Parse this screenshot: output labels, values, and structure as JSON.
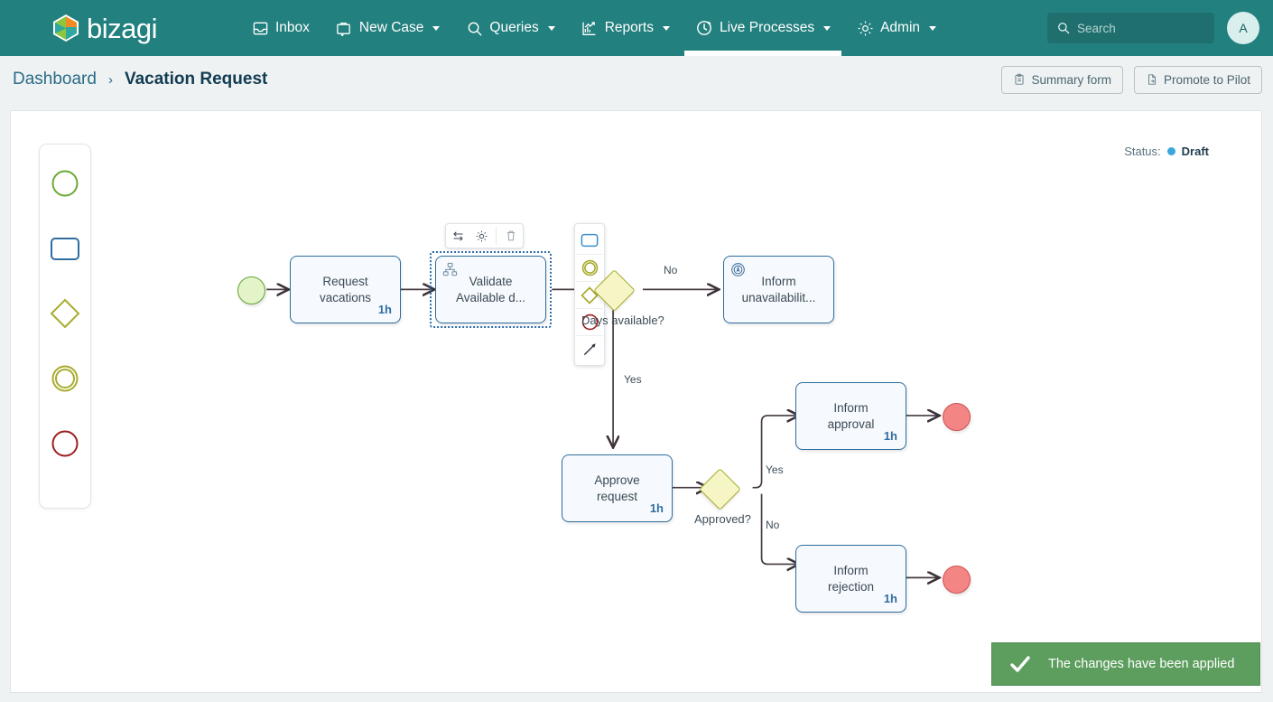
{
  "app": {
    "brand": "bizagi",
    "theme_color": "#22807e"
  },
  "nav": {
    "items": [
      {
        "label": "Inbox",
        "icon": "inbox-icon",
        "has_caret": false,
        "active": false
      },
      {
        "label": "New Case",
        "icon": "new-case-icon",
        "has_caret": true,
        "active": false
      },
      {
        "label": "Queries",
        "icon": "search-icon",
        "has_caret": true,
        "active": false
      },
      {
        "label": "Reports",
        "icon": "reports-chart-icon",
        "has_caret": true,
        "active": false
      },
      {
        "label": "Live Processes",
        "icon": "live-processes-icon",
        "has_caret": true,
        "active": true
      },
      {
        "label": "Admin",
        "icon": "gear-icon",
        "has_caret": true,
        "active": false
      }
    ],
    "search": {
      "value": "",
      "placeholder": "Search"
    },
    "avatar_initial": "A"
  },
  "breadcrumb": {
    "parent": "Dashboard",
    "separator": "›",
    "current": "Vacation Request",
    "actions": [
      {
        "label": "Summary form",
        "icon": "clipboard-icon"
      },
      {
        "label": "Promote to Pilot",
        "icon": "promote-file-icon"
      }
    ]
  },
  "status": {
    "label": "Status:",
    "value": "Draft",
    "dot_color": "#39a7dd"
  },
  "palette": {
    "items": [
      {
        "name": "start-event-shape",
        "shape": "circle",
        "color": "#6aaa33"
      },
      {
        "name": "task-shape",
        "shape": "rounded-rect",
        "color": "#2f6da0"
      },
      {
        "name": "gateway-shape",
        "shape": "diamond",
        "color": "#a8ac2e"
      },
      {
        "name": "intermediate-event-shape",
        "shape": "double-circle",
        "color": "#a8ac2e"
      },
      {
        "name": "end-event-shape",
        "shape": "circle",
        "color": "#9c2020"
      }
    ]
  },
  "context_toolbar": {
    "buttons": [
      {
        "name": "transform-button",
        "icon": "swap-arrows-icon"
      },
      {
        "name": "settings-button",
        "icon": "gear-icon"
      },
      {
        "name": "delete-button",
        "icon": "trash-icon"
      }
    ]
  },
  "quick_palette": {
    "items": [
      {
        "name": "add-task",
        "shape": "rounded-rect",
        "color": "#3d8ecc"
      },
      {
        "name": "add-intermediate-event",
        "shape": "double-circle",
        "color": "#a8ac2e"
      },
      {
        "name": "add-gateway",
        "shape": "diamond",
        "color": "#a8ac2e"
      },
      {
        "name": "add-end-event",
        "shape": "circle",
        "color": "#9c2020"
      },
      {
        "name": "add-connector",
        "shape": "arrow",
        "color": "#2d3742"
      }
    ]
  },
  "diagram": {
    "nodes": [
      {
        "id": "start",
        "type": "start-event",
        "label": ""
      },
      {
        "id": "request",
        "type": "task",
        "label": "Request vacations",
        "duration": "1h",
        "icon": ""
      },
      {
        "id": "validate",
        "type": "task",
        "label": "Validate Available d...",
        "duration": "",
        "icon": "subprocess-icon",
        "selected": true
      },
      {
        "id": "gw_days",
        "type": "gateway",
        "label": "Days available?"
      },
      {
        "id": "unavail",
        "type": "task",
        "label": "Inform unavailabilit...",
        "duration": "",
        "icon": "script-circle-icon"
      },
      {
        "id": "approve",
        "type": "task",
        "label": "Approve request",
        "duration": "1h",
        "icon": ""
      },
      {
        "id": "gw_approved",
        "type": "gateway",
        "label": "Approved?"
      },
      {
        "id": "approval",
        "type": "task",
        "label": "Inform approval",
        "duration": "1h",
        "icon": ""
      },
      {
        "id": "rejection",
        "type": "task",
        "label": "Inform rejection",
        "duration": "1h",
        "icon": ""
      },
      {
        "id": "end1",
        "type": "end-event",
        "label": ""
      },
      {
        "id": "end2",
        "type": "end-event",
        "label": ""
      }
    ],
    "flow_labels": [
      {
        "id": "no_days",
        "text": "No"
      },
      {
        "id": "yes_days",
        "text": "Yes"
      },
      {
        "id": "yes_appr",
        "text": "Yes"
      },
      {
        "id": "no_appr",
        "text": "No"
      }
    ]
  },
  "toast": {
    "message": "The changes have been applied",
    "icon": "check-icon",
    "color": "#5d9e5f"
  }
}
